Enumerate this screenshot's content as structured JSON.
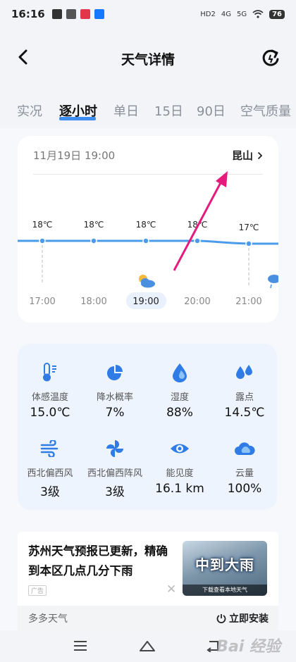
{
  "status_bar": {
    "time": "16:16",
    "network_hd": "HD2",
    "net_4g": "4G",
    "net_5g": "5G",
    "battery": "76"
  },
  "header": {
    "title": "天气详情",
    "back_icon": "back-arrow-icon",
    "refresh_icon": "refresh-icon"
  },
  "tabs": [
    {
      "label": "实况",
      "active": false
    },
    {
      "label": "逐小时",
      "active": true
    },
    {
      "label": "单日",
      "active": false
    },
    {
      "label": "15日",
      "active": false
    },
    {
      "label": "90日",
      "active": false
    },
    {
      "label": "空气质量",
      "active": false
    }
  ],
  "hourly": {
    "datetime": "11月19日 19:00",
    "location": "昆山",
    "accent_color": "#4a9bea",
    "hours": [
      {
        "time": "17:00",
        "temp": "18℃",
        "icon": null,
        "selected": false
      },
      {
        "time": "18:00",
        "temp": "18℃",
        "icon": null,
        "selected": false
      },
      {
        "time": "19:00",
        "temp": "18℃",
        "icon": "partly-cloudy-icon",
        "selected": true
      },
      {
        "time": "20:00",
        "temp": "18℃",
        "icon": null,
        "selected": false
      },
      {
        "time": "21:00",
        "temp": "17℃",
        "icon": null,
        "selected": false
      },
      {
        "time": "",
        "temp": "",
        "icon": "rain-cloud-icon",
        "selected": false
      }
    ]
  },
  "details": [
    {
      "label": "体感温度",
      "value": "15.0℃",
      "icon": "thermometer-icon"
    },
    {
      "label": "降水概率",
      "value": "7%",
      "icon": "pie-chart-icon"
    },
    {
      "label": "湿度",
      "value": "88%",
      "icon": "humidity-drop-icon"
    },
    {
      "label": "露点",
      "value": "14.5℃",
      "icon": "dew-drops-icon"
    },
    {
      "label": "西北偏西风",
      "value": "3级",
      "icon": "wind-icon"
    },
    {
      "label": "西北偏西阵风",
      "value": "3级",
      "icon": "pinwheel-icon"
    },
    {
      "label": "能见度",
      "value": "16.1 km",
      "icon": "eye-icon"
    },
    {
      "label": "云量",
      "value": "100%",
      "icon": "cloud-icon"
    }
  ],
  "ad": {
    "text": "苏州天气预报已更新，精确到本区几点几分下雨",
    "image_title": "中到大雨",
    "image_caption": "下载查看本地天气",
    "tag": "广告",
    "source": "多多天气",
    "install_label": "立即安装"
  },
  "watermark": "Bai 经验"
}
